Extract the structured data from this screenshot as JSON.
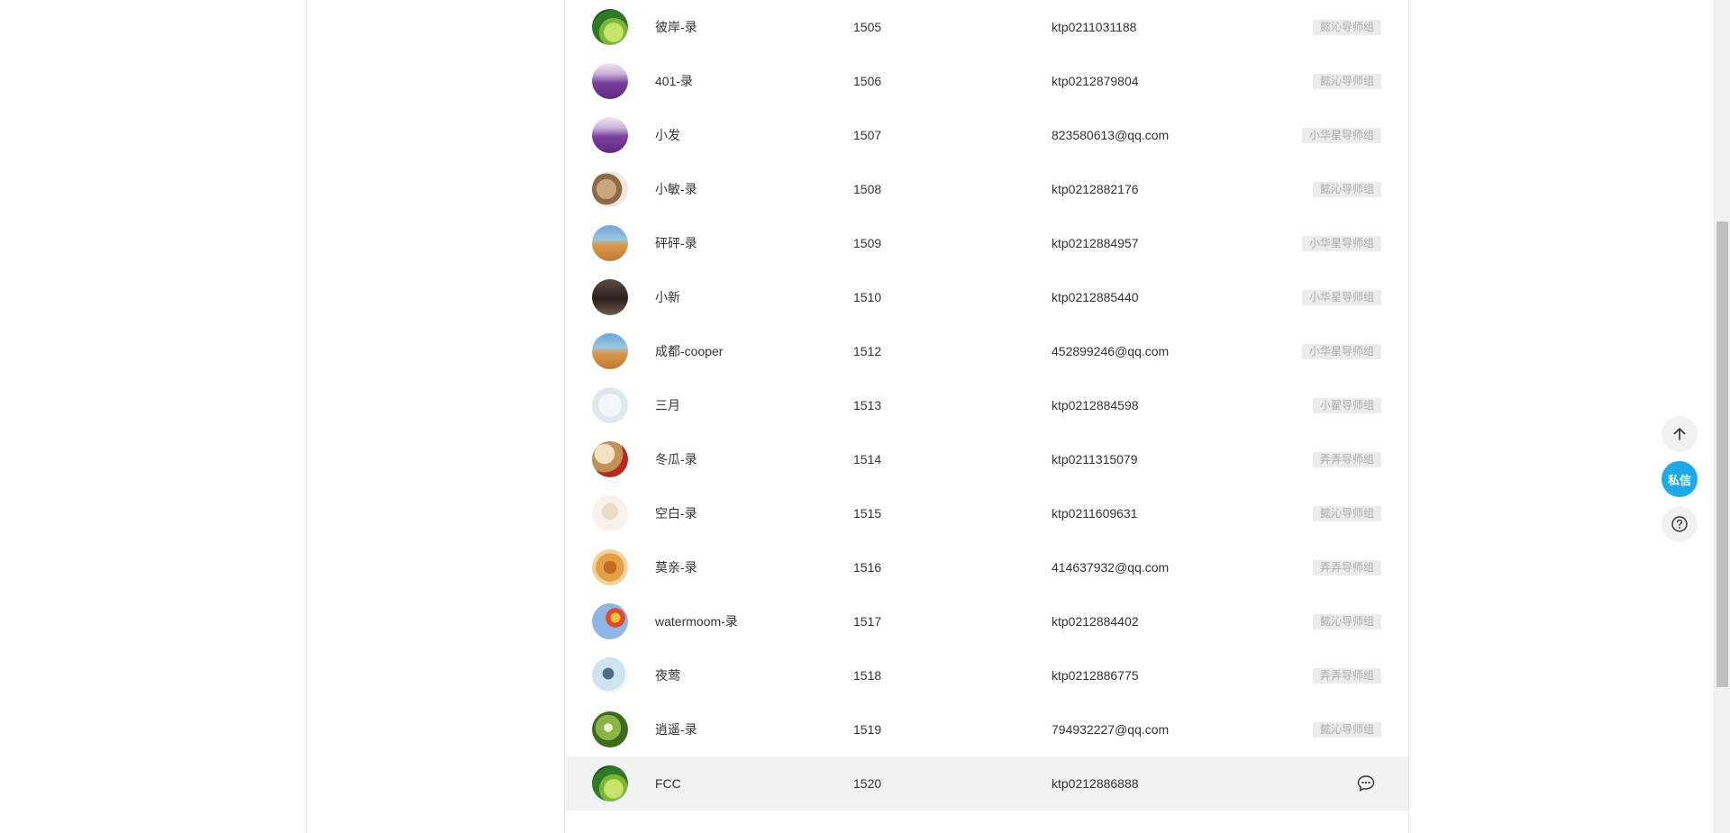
{
  "members": [
    {
      "name": "",
      "id": "",
      "account": "",
      "group": "",
      "avatar": "lake-night",
      "partial": true
    },
    {
      "name": "彼岸-录",
      "id": "1505",
      "account": "ktp0211031188",
      "group": "懿沁导师组",
      "avatar": "lime"
    },
    {
      "name": "401-录",
      "id": "1506",
      "account": "ktp0212879804",
      "group": "懿沁导师组",
      "avatar": "lavender"
    },
    {
      "name": "小发",
      "id": "1507",
      "account": "823580613@qq.com",
      "group": "小华星导师组",
      "avatar": "lavender"
    },
    {
      "name": "小敏-录",
      "id": "1508",
      "account": "ktp0212882176",
      "group": "懿沁导师组",
      "avatar": "danbo"
    },
    {
      "name": "砰砰-录",
      "id": "1509",
      "account": "ktp0212884957",
      "group": "小华星导师组",
      "avatar": "desert"
    },
    {
      "name": "小新",
      "id": "1510",
      "account": "ktp0212885440",
      "group": "小华星导师组",
      "avatar": "bridge"
    },
    {
      "name": "成都-cooper",
      "id": "1512",
      "account": "452899246@qq.com",
      "group": "小华星导师组",
      "avatar": "desert"
    },
    {
      "name": "三月",
      "id": "1513",
      "account": "ktp0212884598",
      "group": "小翟导师组",
      "avatar": "pale"
    },
    {
      "name": "冬瓜-录",
      "id": "1514",
      "account": "ktp0211315079",
      "group": "弄弄导师组",
      "avatar": "fan"
    },
    {
      "name": "空白-录",
      "id": "1515",
      "account": "ktp0211609631",
      "group": "懿沁导师组",
      "avatar": "figure"
    },
    {
      "name": "莫亲-录",
      "id": "1516",
      "account": "414637932@qq.com",
      "group": "弄弄导师组",
      "avatar": "starfish"
    },
    {
      "name": "watermoom-录",
      "id": "1517",
      "account": "ktp0212884402",
      "group": "懿沁导师组",
      "avatar": "balloon"
    },
    {
      "name": "夜莺",
      "id": "1518",
      "account": "ktp0212886775",
      "group": "弄弄导师组",
      "avatar": "bird"
    },
    {
      "name": "逍遥-录",
      "id": "1519",
      "account": "794932227@qq.com",
      "group": "懿沁导师组",
      "avatar": "leaves"
    },
    {
      "name": "FCC",
      "id": "1520",
      "account": "ktp0212886888",
      "group": "",
      "avatar": "lime",
      "hover": true
    }
  ],
  "floating": {
    "message_label": "私信"
  },
  "icons": {
    "back_to_top": "arrow-up-icon",
    "help": "question-circle-icon",
    "chat": "chat-bubble-icon"
  },
  "colors": {
    "accent": "#1fa8e6",
    "badge_bg": "#ececec",
    "badge_text": "#ababab",
    "row_hover": "#f1f2f3"
  }
}
